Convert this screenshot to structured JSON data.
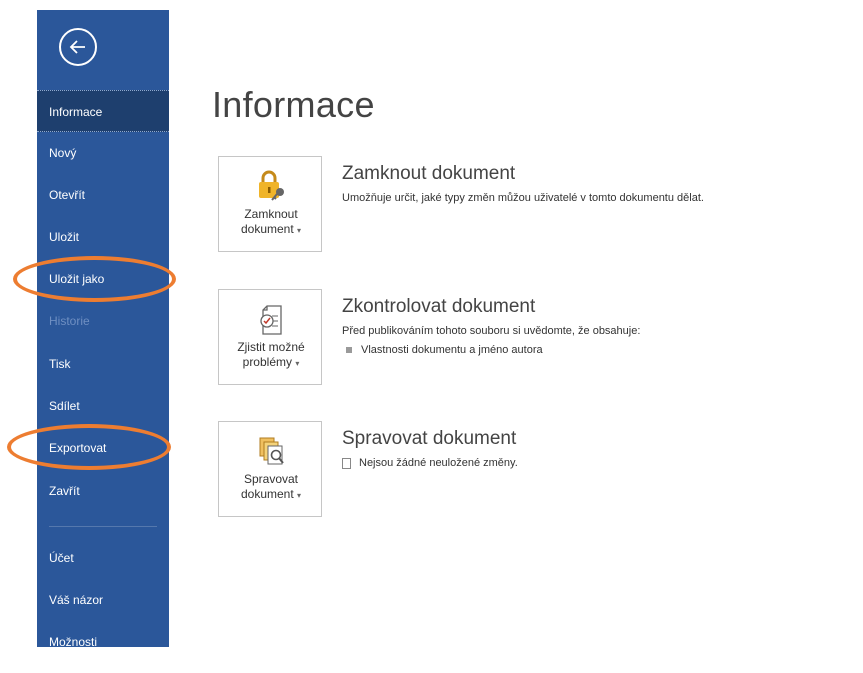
{
  "sidebar": {
    "items": [
      {
        "label": "Informace",
        "active": true
      },
      {
        "label": "Nový"
      },
      {
        "label": "Otevřít"
      },
      {
        "label": "Uložit"
      },
      {
        "label": "Uložit jako",
        "highlighted": true
      },
      {
        "label": "Historie",
        "disabled": true
      },
      {
        "label": "Tisk"
      },
      {
        "label": "Sdílet"
      },
      {
        "label": "Exportovat",
        "highlighted": true
      },
      {
        "label": "Zavřít"
      },
      {
        "label": "Účet"
      },
      {
        "label": "Váš názor"
      },
      {
        "label": "Možnosti"
      }
    ]
  },
  "main": {
    "title": "Informace",
    "sections": [
      {
        "button_line1": "Zamknout",
        "button_line2": "dokument",
        "heading": "Zamknout dokument",
        "description": "Umožňuje určit, jaké typy změn můžou uživatelé v tomto dokumentu dělat."
      },
      {
        "button_line1": "Zjistit možné",
        "button_line2": "problémy",
        "heading": "Zkontrolovat dokument",
        "description": "Před publikováním tohoto souboru si uvědomte, že obsahuje:",
        "bullets": [
          "Vlastnosti dokumentu a jméno autora"
        ]
      },
      {
        "button_line1": "Spravovat",
        "button_line2": "dokument",
        "heading": "Spravovat dokument",
        "status": "Nejsou žádné neuložené změny."
      }
    ]
  },
  "colors": {
    "sidebar_bg": "#2b579a",
    "sidebar_active_bg": "#1e3f6e",
    "highlight_oval": "#ed7d31"
  },
  "icons": [
    "back-arrow-icon",
    "lock-key-icon",
    "check-document-icon",
    "manage-document-icon"
  ]
}
